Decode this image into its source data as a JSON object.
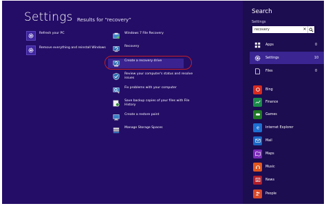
{
  "header": {
    "title": "Settings",
    "results_for": "Results for “recovery”"
  },
  "results": {
    "left_column": [
      {
        "label": "Refresh your PC",
        "icon": "gear-icon"
      },
      {
        "label": "Remove everything and reinstall Windows",
        "icon": "gear-icon"
      }
    ],
    "right_column": [
      {
        "label": "Windows 7 File Recovery",
        "icon": "file-recovery-icon"
      },
      {
        "label": "Recovery",
        "icon": "recovery-icon"
      },
      {
        "label": "Create a recovery drive",
        "icon": "recovery-drive-icon"
      },
      {
        "label": "Review your computer's status and resolve\nissues",
        "icon": "action-center-icon"
      },
      {
        "label": "Fix problems with your computer",
        "icon": "troubleshoot-icon"
      },
      {
        "label": "Save backup copies of your files with File\nHistory",
        "icon": "file-history-icon"
      },
      {
        "label": "Create a restore point",
        "icon": "system-icon"
      },
      {
        "label": "Manage Storage Spaces",
        "icon": "storage-spaces-icon"
      }
    ]
  },
  "search_pane": {
    "title": "Search",
    "scope": "Settings",
    "query": "recovery",
    "clear_glyph": "✕",
    "categories": [
      {
        "label": "Apps",
        "count": "0",
        "color": "#2f2a8a"
      },
      {
        "label": "Settings",
        "count": "10",
        "color": "#3f25a0",
        "selected": true
      },
      {
        "label": "Files",
        "count": "0",
        "color": "#1c0c50"
      },
      {
        "label": "Bing",
        "count": "",
        "color": "#d62b1f"
      },
      {
        "label": "Finance",
        "count": "",
        "color": "#1b8a4a"
      },
      {
        "label": "Games",
        "count": "",
        "color": "#1f7a24"
      },
      {
        "label": "Internet Explorer",
        "count": "",
        "color": "#1d6fd1"
      },
      {
        "label": "Mail",
        "count": "",
        "color": "#1b67c4"
      },
      {
        "label": "Maps",
        "count": "",
        "color": "#7a2bb8"
      },
      {
        "label": "Music",
        "count": "",
        "color": "#e2571e"
      },
      {
        "label": "News",
        "count": "",
        "color": "#b01e2a"
      },
      {
        "label": "People",
        "count": "",
        "color": "#d8492a"
      }
    ]
  },
  "colors": {
    "background": "#240d66",
    "pane": "#1c0c50",
    "highlight_ring": "#c41f28"
  }
}
